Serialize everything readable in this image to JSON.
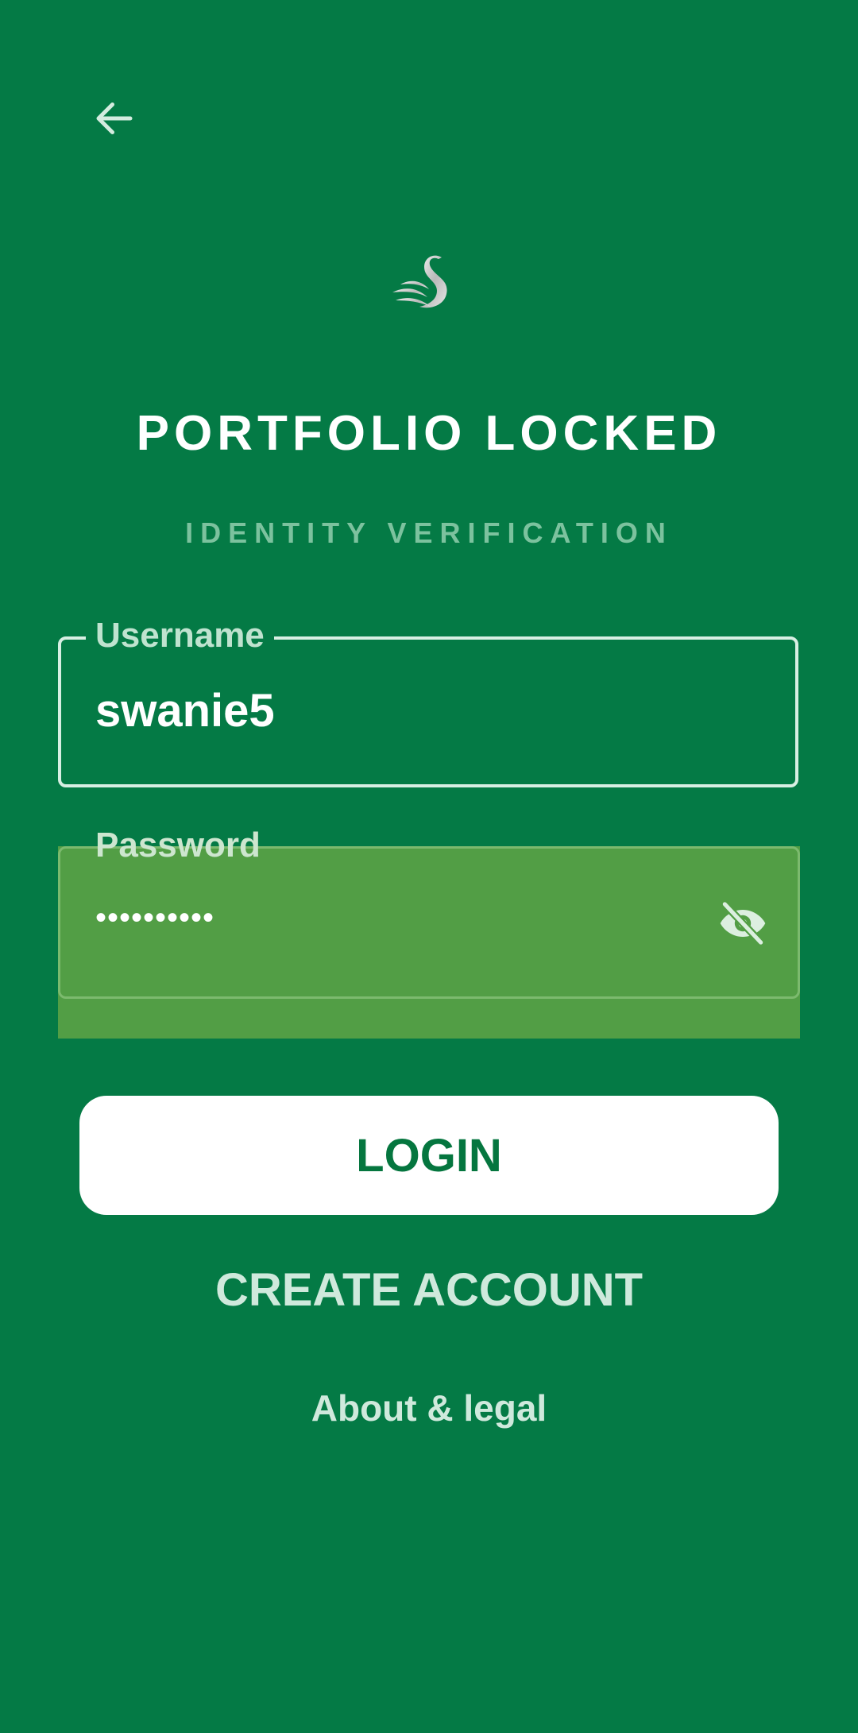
{
  "colors": {
    "background": "#047a45",
    "password_field": "#529e45",
    "button_bg": "#ffffff",
    "button_text": "#05763f"
  },
  "header": {
    "back_icon": "arrow-left-icon",
    "logo_icon": "swan-logo-icon"
  },
  "title": "PORTFOLIO LOCKED",
  "subtitle": "IDENTITY VERIFICATION",
  "form": {
    "username": {
      "label": "Username",
      "value": "swanie5"
    },
    "password": {
      "label": "Password",
      "value": "••••••••••",
      "toggle_icon": "eye-off-icon"
    }
  },
  "actions": {
    "login_label": "LOGIN",
    "create_account_label": "CREATE ACCOUNT",
    "about_label": "About & legal"
  }
}
